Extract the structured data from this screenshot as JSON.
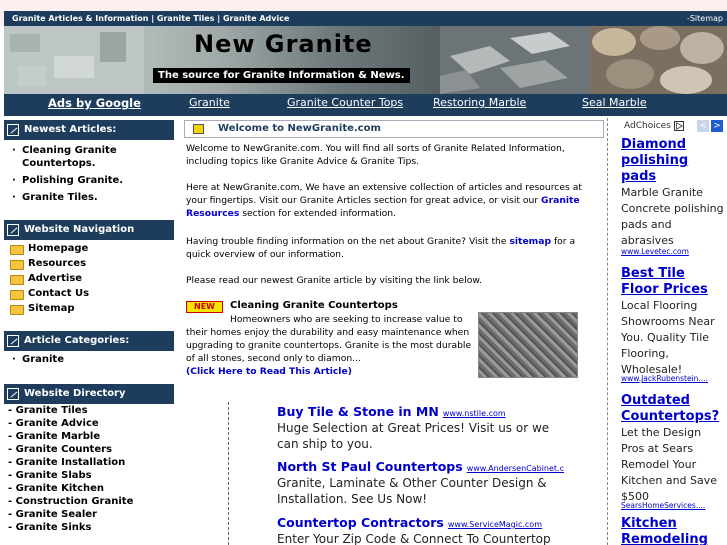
{
  "topbar": {
    "links": [
      "Granite Articles & Information",
      "Granite Tiles",
      "Granite Advice"
    ],
    "separator": "|",
    "sitemap": "-Sitemap"
  },
  "banner": {
    "title": "New Granite",
    "subtitle": "The source for Granite Information & News."
  },
  "nav": {
    "ads_label": "Ads by Google",
    "links": [
      "Granite",
      "Granite Counter Tops",
      "Restoring Marble",
      "Seal Marble"
    ]
  },
  "sidebar": {
    "newest": {
      "heading": "Newest Articles:",
      "items": [
        "Cleaning Granite Countertops.",
        "Polishing Granite.",
        "Granite Tiles."
      ]
    },
    "navigation": {
      "heading": "Website Navigation",
      "items": [
        "Homepage",
        "Resources",
        "Advertise",
        "Contact Us",
        "Sitemap"
      ]
    },
    "categories": {
      "heading": "Article Categories:",
      "items": [
        "Granite"
      ]
    },
    "directory": {
      "heading": "Website Directory",
      "items": [
        "- Granite Tiles",
        "- Granite Advice",
        "- Granite Marble",
        "- Granite Counters",
        "- Granite Installation",
        "- Granite Slabs",
        "- Granite Kitchen",
        "- Construction Granite",
        "- Granite Sealer",
        "- Granite Sinks"
      ]
    }
  },
  "main": {
    "welcome": "Welcome to NewGranite.com",
    "p1": "Welcome to NewGranite.com. You will find all sorts of Granite Related Information, including topics like Granite Advice & Granite Tips.",
    "p2a": "Here at NewGranite.com, We have an extensive collection of articles and resources at your fingertips. Visit our Granite Articles section for great advice, or visit our ",
    "p2link": "Granite Resources",
    "p2b": " section for extended information.",
    "p3a": "Having trouble finding information on the net about Granite? Visit the ",
    "p3link": "sitemap",
    "p3b": " for a quick overview of our information.",
    "p4": "Please read our newest Granite article by visiting the link below.",
    "new_badge": "NEW",
    "article_title": "Cleaning Granite Countertops",
    "article_body": "Homeowners who are seeking to increase value to their homes enjoy the durability and easy maintenance when upgrading to granite countertops. Granite is the most durable of all stones, second only to diamon...",
    "article_link": "(Click Here to Read This Article)"
  },
  "center_ads": [
    {
      "title": "Buy Tile & Stone in MN",
      "url": "www.nstile.com",
      "body": "Huge Selection at Great Prices! Visit us or we can ship to you."
    },
    {
      "title": "North St Paul Countertops",
      "url": "www.AndersenCabinet.c",
      "body": "Granite, Laminate & Other Counter Design & Installation. See Us Now!"
    },
    {
      "title": "Countertop Contractors",
      "url": "www.ServiceMagic.com",
      "body": "Enter Your Zip Code & Connect To Countertop"
    }
  ],
  "right_ads": {
    "adchoices": "AdChoices",
    "prev": "<",
    "next": ">",
    "items": [
      {
        "title": "Diamond polishing pads",
        "body": "Marble Granite Concrete polishing pads and abrasives",
        "url": "www.Levetec.com"
      },
      {
        "title": "Best Tile Floor Prices",
        "body": "Local Flooring Showrooms Near You. Quality Tile Flooring, Wholesale!",
        "url": "www.JackRubenstein...."
      },
      {
        "title": "Outdated Countertops?",
        "body": "Let the Design Pros at Sears Remodel Your Kitchen and Save $500",
        "url": "SearsHomeServices...."
      },
      {
        "title": "Kitchen Remodeling",
        "body": "",
        "url": ""
      }
    ]
  }
}
